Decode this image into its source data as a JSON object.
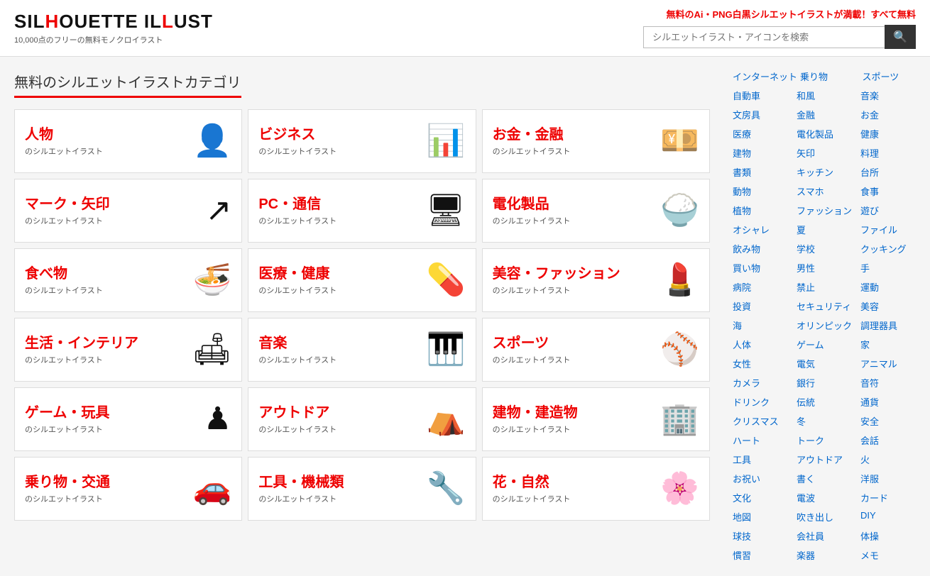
{
  "header": {
    "logo_title": "SILHOUETTE ILLUST",
    "logo_sub": "10,000点のフリーの無料モノクロイラスト",
    "tagline_pre": "無料のAi・PNG白黒シルエットイラスト",
    "tagline_em": "が満載！すべて無料",
    "search_placeholder": "シルエットイラスト・アイコンを検索",
    "search_icon": "🔍"
  },
  "main": {
    "heading": "無料のシルエットイラストカテゴリ",
    "categories": [
      {
        "title": "人物",
        "sub": "のシルエットイラスト",
        "icon": "👤"
      },
      {
        "title": "ビジネス",
        "sub": "のシルエットイラスト",
        "icon": "📊"
      },
      {
        "title": "お金・金融",
        "sub": "のシルエットイラスト",
        "icon": "💴"
      },
      {
        "title": "マーク・矢印",
        "sub": "のシルエットイラスト",
        "icon": "↗"
      },
      {
        "title": "PC・通信",
        "sub": "のシルエットイラスト",
        "icon": "🖥"
      },
      {
        "title": "電化製品",
        "sub": "のシルエットイラスト",
        "icon": "🍚"
      },
      {
        "title": "食べ物",
        "sub": "のシルエットイラスト",
        "icon": "🍜"
      },
      {
        "title": "医療・健康",
        "sub": "のシルエットイラスト",
        "icon": "💊"
      },
      {
        "title": "美容・ファッション",
        "sub": "のシルエットイラスト",
        "icon": "💄"
      },
      {
        "title": "生活・インテリア",
        "sub": "のシルエットイラスト",
        "icon": "🛋"
      },
      {
        "title": "音楽",
        "sub": "のシルエットイラスト",
        "icon": "🎹"
      },
      {
        "title": "スポーツ",
        "sub": "のシルエットイラスト",
        "icon": "⚾"
      },
      {
        "title": "ゲーム・玩具",
        "sub": "のシルエットイラスト",
        "icon": "♟"
      },
      {
        "title": "アウトドア",
        "sub": "のシルエットイラスト",
        "icon": "⛺"
      },
      {
        "title": "建物・建造物",
        "sub": "のシルエットイラスト",
        "icon": "🏢"
      },
      {
        "title": "乗り物・交通",
        "sub": "のシルエットイラスト",
        "icon": "🚗"
      },
      {
        "title": "工具・機械類",
        "sub": "のシルエットイラスト",
        "icon": "🔧"
      },
      {
        "title": "花・自然",
        "sub": "のシルエットイラスト",
        "icon": "🌸"
      }
    ]
  },
  "sidebar": {
    "rows": [
      [
        "インターネット",
        "乗り物",
        "スポーツ"
      ],
      [
        "自動車",
        "和風",
        "音楽"
      ],
      [
        "文房具",
        "金融",
        "お金"
      ],
      [
        "医療",
        "電化製品",
        "健康"
      ],
      [
        "建物",
        "矢印",
        "料理"
      ],
      [
        "書類",
        "キッチン",
        "台所"
      ],
      [
        "動物",
        "スマホ",
        "食事"
      ],
      [
        "植物",
        "ファッション",
        "遊び"
      ],
      [
        "オシャレ",
        "夏",
        "ファイル"
      ],
      [
        "飲み物",
        "学校",
        "クッキング"
      ],
      [
        "買い物",
        "男性",
        "手"
      ],
      [
        "病院",
        "禁止",
        "運動"
      ],
      [
        "投資",
        "セキュリティ",
        "美容"
      ],
      [
        "海",
        "オリンピック",
        "調理器具"
      ],
      [
        "人体",
        "ゲーム",
        "家"
      ],
      [
        "女性",
        "電気",
        "アニマル"
      ],
      [
        "カメラ",
        "銀行",
        "音符"
      ],
      [
        "ドリンク",
        "伝統",
        "通貨"
      ],
      [
        "クリスマス",
        "冬",
        "安全"
      ],
      [
        "ハート",
        "トーク",
        "会話"
      ],
      [
        "工具",
        "アウトドア",
        "火"
      ],
      [
        "お祝い",
        "書く",
        "洋服"
      ],
      [
        "文化",
        "電波",
        "カード"
      ],
      [
        "地図",
        "吹き出し",
        "DIY"
      ],
      [
        "球技",
        "会社員",
        "体操"
      ],
      [
        "慣習",
        "楽器",
        "メモ"
      ]
    ]
  }
}
